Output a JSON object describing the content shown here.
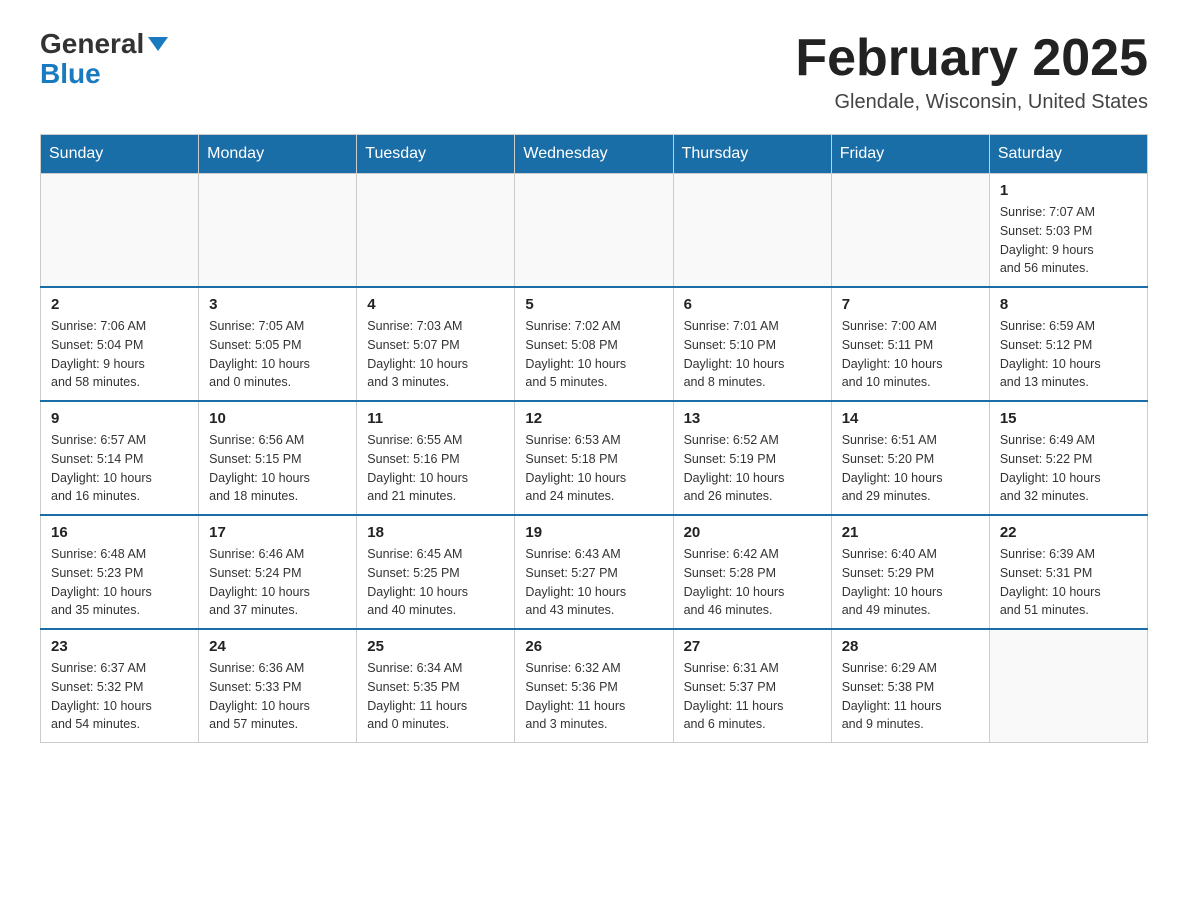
{
  "header": {
    "logo_line1": "General",
    "logo_line2": "Blue",
    "month_title": "February 2025",
    "location": "Glendale, Wisconsin, United States"
  },
  "weekdays": [
    "Sunday",
    "Monday",
    "Tuesday",
    "Wednesday",
    "Thursday",
    "Friday",
    "Saturday"
  ],
  "weeks": [
    [
      {
        "day": "",
        "info": ""
      },
      {
        "day": "",
        "info": ""
      },
      {
        "day": "",
        "info": ""
      },
      {
        "day": "",
        "info": ""
      },
      {
        "day": "",
        "info": ""
      },
      {
        "day": "",
        "info": ""
      },
      {
        "day": "1",
        "info": "Sunrise: 7:07 AM\nSunset: 5:03 PM\nDaylight: 9 hours\nand 56 minutes."
      }
    ],
    [
      {
        "day": "2",
        "info": "Sunrise: 7:06 AM\nSunset: 5:04 PM\nDaylight: 9 hours\nand 58 minutes."
      },
      {
        "day": "3",
        "info": "Sunrise: 7:05 AM\nSunset: 5:05 PM\nDaylight: 10 hours\nand 0 minutes."
      },
      {
        "day": "4",
        "info": "Sunrise: 7:03 AM\nSunset: 5:07 PM\nDaylight: 10 hours\nand 3 minutes."
      },
      {
        "day": "5",
        "info": "Sunrise: 7:02 AM\nSunset: 5:08 PM\nDaylight: 10 hours\nand 5 minutes."
      },
      {
        "day": "6",
        "info": "Sunrise: 7:01 AM\nSunset: 5:10 PM\nDaylight: 10 hours\nand 8 minutes."
      },
      {
        "day": "7",
        "info": "Sunrise: 7:00 AM\nSunset: 5:11 PM\nDaylight: 10 hours\nand 10 minutes."
      },
      {
        "day": "8",
        "info": "Sunrise: 6:59 AM\nSunset: 5:12 PM\nDaylight: 10 hours\nand 13 minutes."
      }
    ],
    [
      {
        "day": "9",
        "info": "Sunrise: 6:57 AM\nSunset: 5:14 PM\nDaylight: 10 hours\nand 16 minutes."
      },
      {
        "day": "10",
        "info": "Sunrise: 6:56 AM\nSunset: 5:15 PM\nDaylight: 10 hours\nand 18 minutes."
      },
      {
        "day": "11",
        "info": "Sunrise: 6:55 AM\nSunset: 5:16 PM\nDaylight: 10 hours\nand 21 minutes."
      },
      {
        "day": "12",
        "info": "Sunrise: 6:53 AM\nSunset: 5:18 PM\nDaylight: 10 hours\nand 24 minutes."
      },
      {
        "day": "13",
        "info": "Sunrise: 6:52 AM\nSunset: 5:19 PM\nDaylight: 10 hours\nand 26 minutes."
      },
      {
        "day": "14",
        "info": "Sunrise: 6:51 AM\nSunset: 5:20 PM\nDaylight: 10 hours\nand 29 minutes."
      },
      {
        "day": "15",
        "info": "Sunrise: 6:49 AM\nSunset: 5:22 PM\nDaylight: 10 hours\nand 32 minutes."
      }
    ],
    [
      {
        "day": "16",
        "info": "Sunrise: 6:48 AM\nSunset: 5:23 PM\nDaylight: 10 hours\nand 35 minutes."
      },
      {
        "day": "17",
        "info": "Sunrise: 6:46 AM\nSunset: 5:24 PM\nDaylight: 10 hours\nand 37 minutes."
      },
      {
        "day": "18",
        "info": "Sunrise: 6:45 AM\nSunset: 5:25 PM\nDaylight: 10 hours\nand 40 minutes."
      },
      {
        "day": "19",
        "info": "Sunrise: 6:43 AM\nSunset: 5:27 PM\nDaylight: 10 hours\nand 43 minutes."
      },
      {
        "day": "20",
        "info": "Sunrise: 6:42 AM\nSunset: 5:28 PM\nDaylight: 10 hours\nand 46 minutes."
      },
      {
        "day": "21",
        "info": "Sunrise: 6:40 AM\nSunset: 5:29 PM\nDaylight: 10 hours\nand 49 minutes."
      },
      {
        "day": "22",
        "info": "Sunrise: 6:39 AM\nSunset: 5:31 PM\nDaylight: 10 hours\nand 51 minutes."
      }
    ],
    [
      {
        "day": "23",
        "info": "Sunrise: 6:37 AM\nSunset: 5:32 PM\nDaylight: 10 hours\nand 54 minutes."
      },
      {
        "day": "24",
        "info": "Sunrise: 6:36 AM\nSunset: 5:33 PM\nDaylight: 10 hours\nand 57 minutes."
      },
      {
        "day": "25",
        "info": "Sunrise: 6:34 AM\nSunset: 5:35 PM\nDaylight: 11 hours\nand 0 minutes."
      },
      {
        "day": "26",
        "info": "Sunrise: 6:32 AM\nSunset: 5:36 PM\nDaylight: 11 hours\nand 3 minutes."
      },
      {
        "day": "27",
        "info": "Sunrise: 6:31 AM\nSunset: 5:37 PM\nDaylight: 11 hours\nand 6 minutes."
      },
      {
        "day": "28",
        "info": "Sunrise: 6:29 AM\nSunset: 5:38 PM\nDaylight: 11 hours\nand 9 minutes."
      },
      {
        "day": "",
        "info": ""
      }
    ]
  ]
}
